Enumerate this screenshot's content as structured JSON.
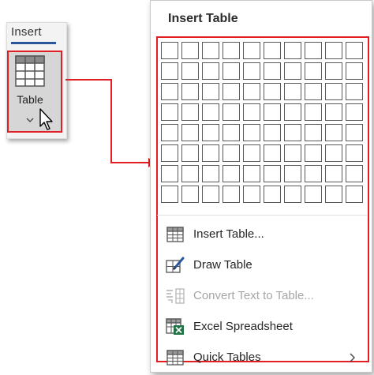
{
  "ribbon": {
    "tab_label": "Insert",
    "table_button_label": "Table"
  },
  "dropdown": {
    "title": "Insert Table",
    "grid": {
      "columns": 10,
      "rows": 8
    },
    "menu_items": [
      {
        "label": "Insert Table...",
        "icon": "insert-table-icon",
        "enabled": true,
        "submenu": false
      },
      {
        "label": "Draw Table",
        "icon": "draw-table-icon",
        "enabled": true,
        "submenu": false
      },
      {
        "label": "Convert Text to Table...",
        "icon": "convert-text-to-table-icon",
        "enabled": false,
        "submenu": false
      },
      {
        "label": "Excel Spreadsheet",
        "icon": "excel-spreadsheet-icon",
        "enabled": true,
        "submenu": false
      },
      {
        "label": "Quick Tables",
        "icon": "quick-tables-icon",
        "enabled": true,
        "submenu": true
      }
    ]
  },
  "colors": {
    "highlight": "#e01e24",
    "tab_underline": "#2b579a",
    "excel_green": "#217346"
  }
}
